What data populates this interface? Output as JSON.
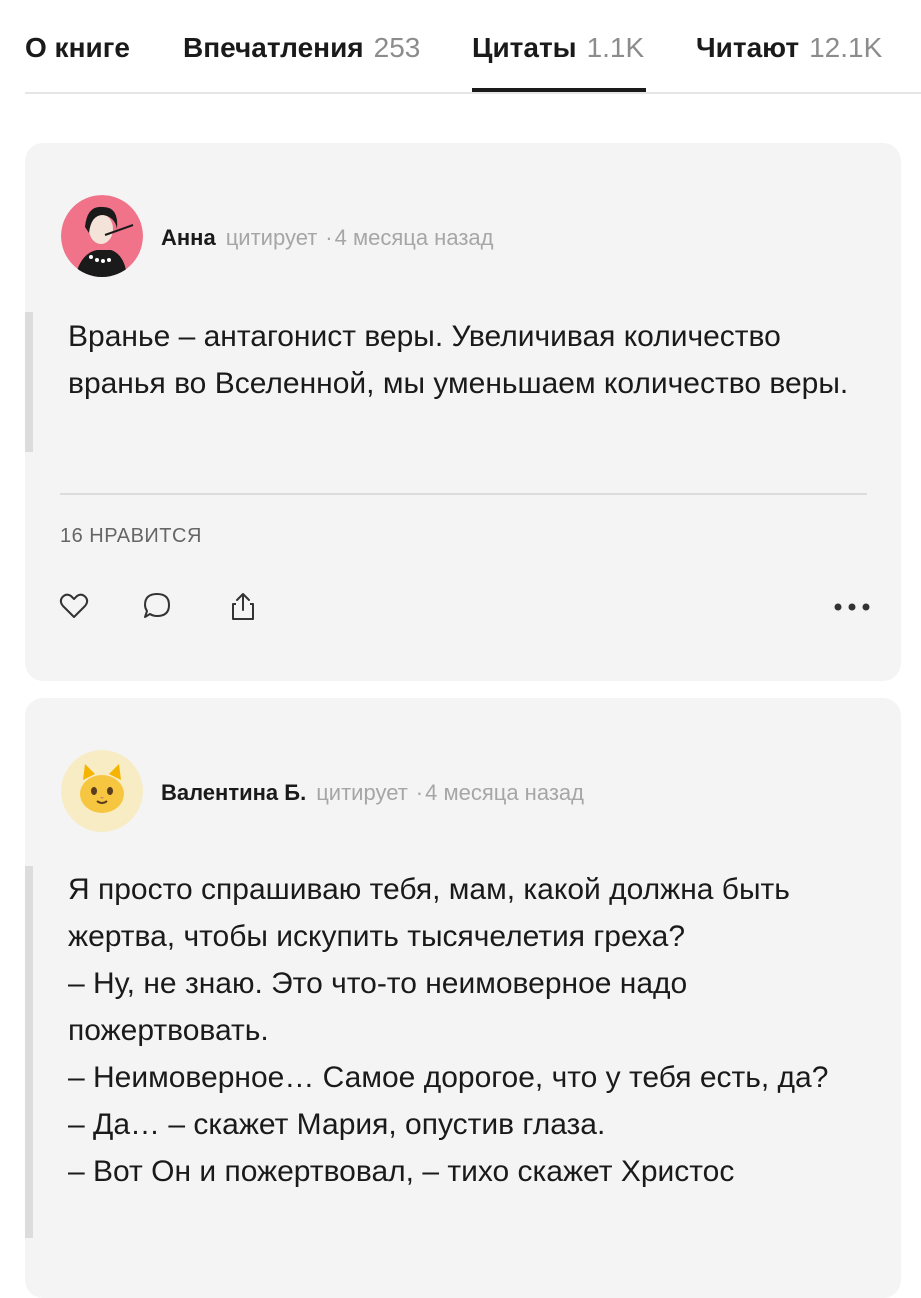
{
  "tabs": [
    {
      "label": "О книге",
      "count": ""
    },
    {
      "label": "Впечатления",
      "count": "253"
    },
    {
      "label": "Цитаты",
      "count": "1.1K"
    },
    {
      "label": "Читают",
      "count": "12.1K"
    }
  ],
  "active_tab": "Цитаты",
  "quotes": [
    {
      "author": "Анна",
      "verb": "цитирует",
      "time": "4 месяца назад",
      "text": "Вранье – антагонист веры. Увеличивая количество вранья во Вселенной, мы уменьшаем количество веры.",
      "likes": "16 НРАВИТСЯ"
    },
    {
      "author": "Валентина Б.",
      "verb": "цитирует",
      "time": "4 месяца назад",
      "text": "Я просто спрашиваю тебя, мам, какой должна быть жертва, чтобы искупить тысячелетия греха?\n– Ну, не знаю. Это что-то неимоверное надо пожертвовать.\n– Неимоверное… Самое дорогое, что у тебя есть, да?\n– Да… – скажет Мария, опустив глаза.\n– Вот Он и пожертвовал, – тихо скажет Христос"
    }
  ],
  "colors": {
    "accent": "#1a1a1a",
    "card": "#f4f4f4",
    "muted": "#a6a6a6",
    "avatar1_bg": "#f0738a",
    "avatar2_bg": "#f7ecc4"
  },
  "icons": [
    "heart-icon",
    "comment-icon",
    "share-icon",
    "more-icon"
  ]
}
